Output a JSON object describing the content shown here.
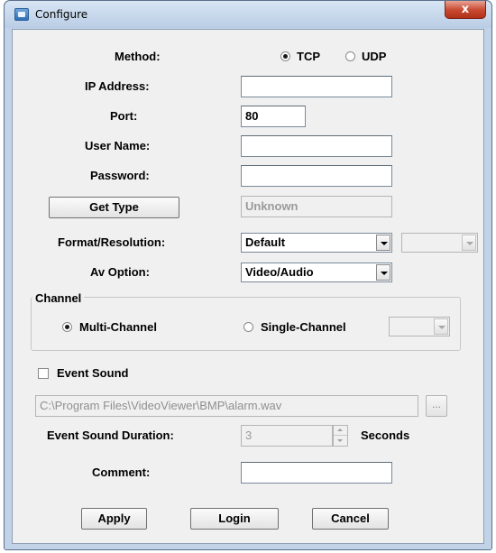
{
  "window": {
    "title": "Configure",
    "close_label": "x"
  },
  "method": {
    "label": "Method:",
    "options": [
      "TCP",
      "UDP"
    ],
    "selected": "TCP"
  },
  "ip_address": {
    "label": "IP Address:",
    "value": ""
  },
  "port": {
    "label": "Port:",
    "value": "80"
  },
  "user_name": {
    "label": "User Name:",
    "value": ""
  },
  "password": {
    "label": "Password:",
    "value": ""
  },
  "get_type": {
    "button_label": "Get Type",
    "value": "Unknown"
  },
  "format_resolution": {
    "label": "Format/Resolution:",
    "selected": "Default",
    "secondary_selected": ""
  },
  "av_option": {
    "label": "Av Option:",
    "selected": "Video/Audio"
  },
  "channel": {
    "group_title": "Channel",
    "options": [
      "Multi-Channel",
      "Single-Channel"
    ],
    "selected": "Multi-Channel",
    "single_channel_value": ""
  },
  "event_sound": {
    "label": "Event Sound",
    "checked": false,
    "file_path": "C:\\Program Files\\VideoViewer\\BMP\\alarm.wav",
    "browse_label": "...",
    "duration_label": "Event Sound Duration:",
    "duration_value": "3",
    "duration_unit": "Seconds"
  },
  "comment": {
    "label": "Comment:",
    "value": ""
  },
  "buttons": {
    "apply": "Apply",
    "login": "Login",
    "cancel": "Cancel"
  }
}
